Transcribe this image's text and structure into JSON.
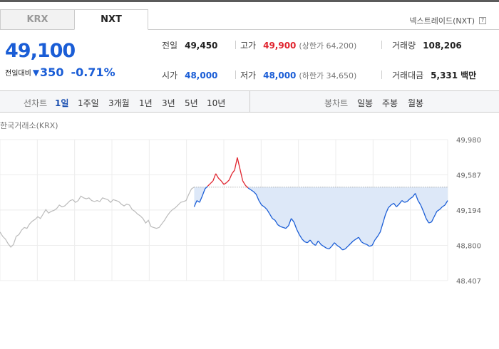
{
  "tabs": [
    {
      "label": "KRX",
      "active": false
    },
    {
      "label": "NXT",
      "active": true
    }
  ],
  "exchange_label": "넥스트레이드(NXT)",
  "help_icon_glyph": "?",
  "current_price": "49,100",
  "change": {
    "label": "전일대비",
    "icon": "down-triangle-icon",
    "glyph": "▼",
    "amount": "350",
    "rate": "-0.71%"
  },
  "stats": {
    "prev_close": {
      "label": "전일",
      "value": "49,450"
    },
    "high": {
      "label": "고가",
      "value": "49,900",
      "sub": "(상한가 64,200)"
    },
    "volume": {
      "label": "거래량",
      "value": "108,206"
    },
    "open": {
      "label": "시가",
      "value": "48,000"
    },
    "low": {
      "label": "저가",
      "value": "48,000",
      "sub": "(하한가 34,650)"
    },
    "amount": {
      "label": "거래대금",
      "value": "5,331",
      "unit": "백만"
    }
  },
  "toolbar": {
    "line_title": "선차트",
    "line_periods": [
      "1일",
      "1주일",
      "3개월",
      "1년",
      "3년",
      "5년",
      "10년"
    ],
    "selected_period": "1일",
    "candle_title": "봉차트",
    "candle_periods": [
      "일봉",
      "주봉",
      "월봉"
    ]
  },
  "colors": {
    "up": "#e0242e",
    "down": "#1a5dd6",
    "fill": "#dde8f8",
    "previous": "#bbbbbb"
  },
  "chart_data": {
    "type": "line",
    "title": "한국거래소(KRX)",
    "y_ticks": [
      "49,980",
      "49,587",
      "49,194",
      "48,800",
      "48,407"
    ],
    "ylim": [
      48407,
      49980
    ],
    "reference_price": 49450,
    "grid": true,
    "series": [
      {
        "values": [
          48950,
          48900,
          48870,
          48820,
          48780,
          48810,
          48900,
          48920,
          48970,
          49000,
          48990,
          49040,
          49070,
          49090,
          49120,
          49100,
          49150,
          49200,
          49160,
          49180,
          49190,
          49210,
          49250,
          49230,
          49240,
          49270,
          49300,
          49310,
          49280,
          49300,
          49350,
          49330,
          49320,
          49330,
          49300,
          49290,
          49300,
          49290,
          49330,
          49320,
          49310,
          49280,
          49310,
          49300,
          49290,
          49260,
          49240,
          49260,
          49250,
          49200,
          49180,
          49150,
          49130,
          49100,
          49050,
          49080,
          49010,
          49000,
          48990,
          49000,
          49040,
          49080,
          49130,
          49170,
          49200,
          49220,
          49250,
          49280,
          49290,
          49300,
          49370,
          49430,
          49450
        ]
      },
      {
        "values": [
          49230,
          49300,
          49280,
          49350,
          49430,
          49460,
          49490,
          49520,
          49600,
          49550,
          49520,
          49480,
          49500,
          49530,
          49600,
          49640,
          49780,
          49650,
          49520,
          49470,
          49440,
          49420,
          49400,
          49370,
          49300,
          49250,
          49230,
          49200,
          49150,
          49100,
          49080,
          49030,
          49010,
          49000,
          48990,
          49020,
          49100,
          49060,
          48980,
          48920,
          48870,
          48840,
          48830,
          48860,
          48820,
          48800,
          48850,
          48810,
          48790,
          48770,
          48760,
          48790,
          48830,
          48800,
          48780,
          48750,
          48760,
          48790,
          48820,
          48850,
          48870,
          48890,
          48840,
          48820,
          48810,
          48790,
          48800,
          48860,
          48900,
          48950,
          49050,
          49150,
          49220,
          49250,
          49270,
          49230,
          49260,
          49300,
          49280,
          49290,
          49320,
          49340,
          49380,
          49300,
          49250,
          49180,
          49100,
          49050,
          49060,
          49120,
          49180,
          49200,
          49230,
          49250,
          49300
        ]
      }
    ]
  }
}
